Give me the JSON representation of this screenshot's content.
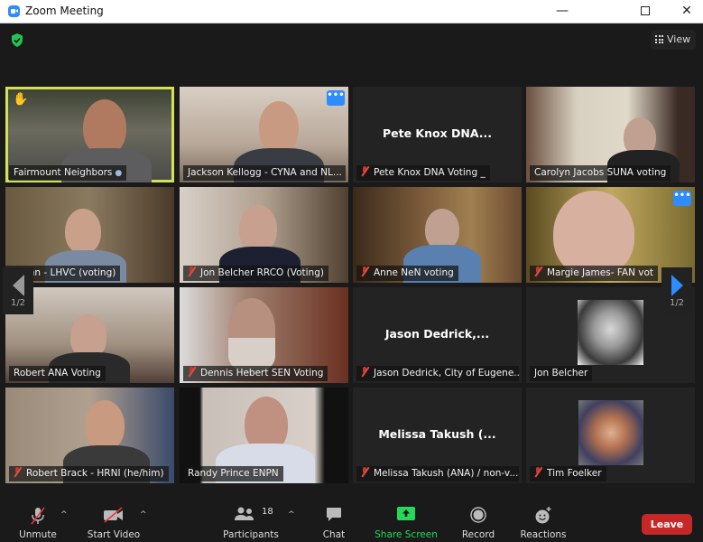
{
  "window": {
    "title": "Zoom Meeting",
    "controls": [
      "minimize",
      "maximize",
      "close"
    ]
  },
  "header": {
    "security_icon": "shield-check-icon",
    "view_label": "View"
  },
  "pagination": {
    "left_page": "1/2",
    "right_page": "1/2"
  },
  "tiles": [
    {
      "name": "Fairmount Neighbors",
      "muted": false,
      "video": true,
      "active_speaker": true,
      "hand_raised": true
    },
    {
      "name": "Jackson Kellogg - CYNA and NL...",
      "muted": false,
      "video": true,
      "more_menu": true
    },
    {
      "name": "Pete Knox DNA Voting _",
      "center_name": "Pete Knox DNA...",
      "muted": true,
      "video": false
    },
    {
      "name": "Carolyn Jacobs SUNA voting",
      "muted": false,
      "video": true
    },
    {
      "name": "tmann - LHVC (voting)",
      "muted": false,
      "video": true
    },
    {
      "name": "Jon Belcher RRCO (Voting)",
      "muted": true,
      "video": true
    },
    {
      "name": "Anne NeN voting",
      "muted": true,
      "video": true
    },
    {
      "name": "Margie James- FAN vot",
      "muted": true,
      "video": true,
      "more_menu": true
    },
    {
      "name": "Robert ANA Voting",
      "muted": false,
      "video": true
    },
    {
      "name": "Dennis Hebert SEN Voting",
      "muted": true,
      "video": true
    },
    {
      "name": "Jason Dedrick, City of Eugene...",
      "center_name": "Jason  Dedrick,...",
      "muted": true,
      "video": false
    },
    {
      "name": "Jon Belcher",
      "muted": false,
      "video": false,
      "profile_photo": true
    },
    {
      "name": "Robert Brack - HRNI (he/him)",
      "muted": true,
      "video": true
    },
    {
      "name": "Randy Prince ENPN",
      "muted": false,
      "video": true
    },
    {
      "name": "Melissa Takush (ANA) / non-v...",
      "center_name": "Melissa Takush (...",
      "muted": true,
      "video": false
    },
    {
      "name": "Tim Foelker",
      "muted": true,
      "video": false,
      "profile_photo": true
    }
  ],
  "toolbar": {
    "unmute": "Unmute",
    "start_video": "Start Video",
    "participants": "Participants",
    "participants_count": "18",
    "chat": "Chat",
    "share_screen": "Share Screen",
    "record": "Record",
    "reactions": "Reactions",
    "leave": "Leave"
  },
  "colors": {
    "accent_blue": "#2d8cff",
    "share_green": "#23d959",
    "leave_red": "#c62828",
    "active_speaker": "#d4e157"
  }
}
